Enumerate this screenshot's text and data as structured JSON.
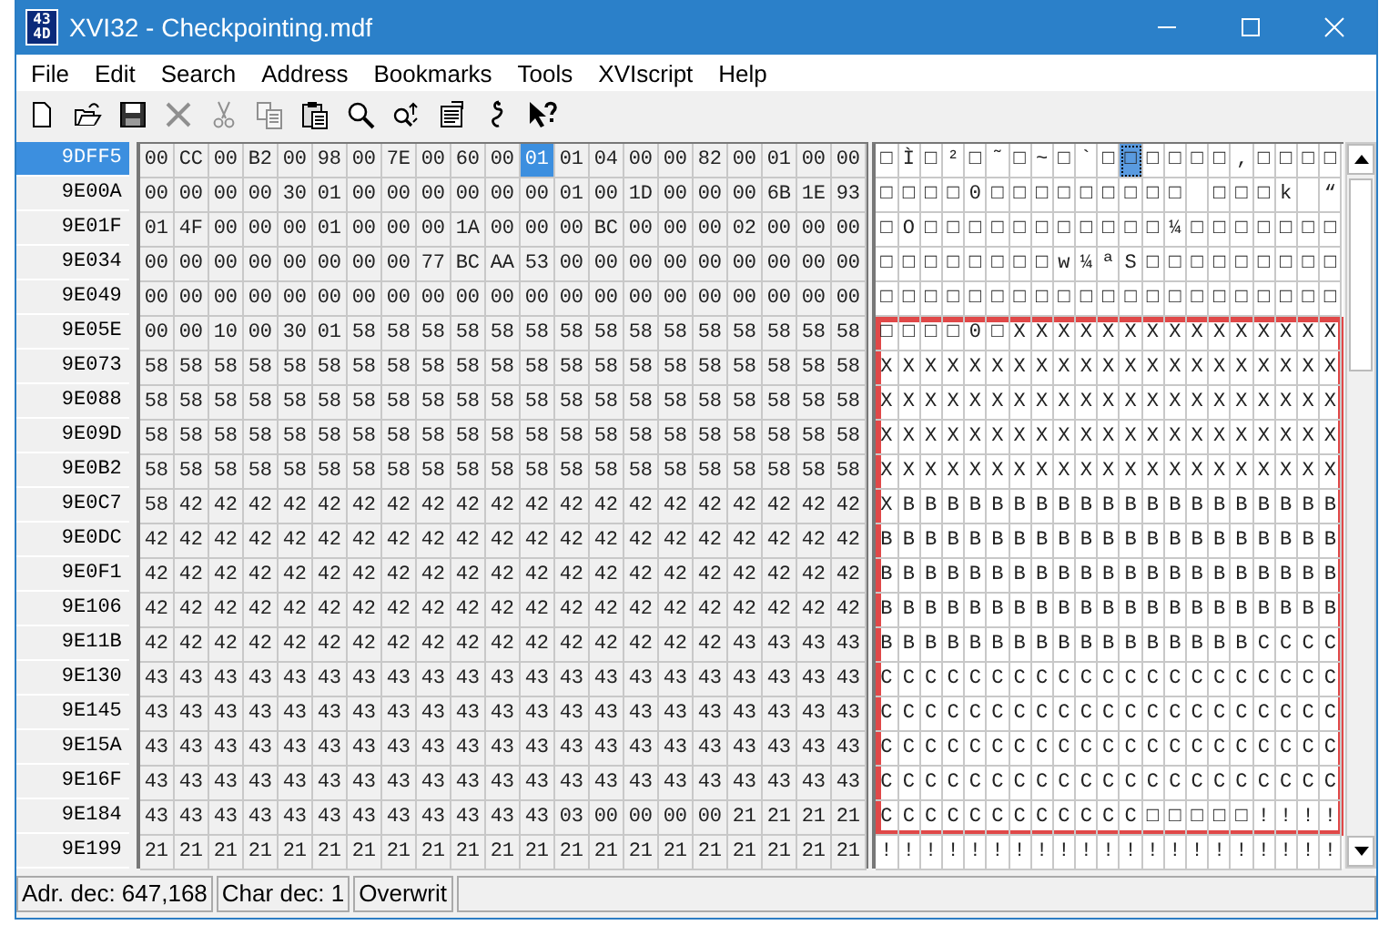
{
  "window": {
    "title": "XVI32 - Checkpointing.mdf",
    "icon_text": [
      "43",
      "4D"
    ]
  },
  "menu": [
    "File",
    "Edit",
    "Search",
    "Address",
    "Bookmarks",
    "Tools",
    "XVIscript",
    "Help"
  ],
  "toolbar": [
    {
      "kind": "new",
      "disabled": false
    },
    {
      "kind": "open",
      "disabled": false
    },
    {
      "kind": "save",
      "disabled": false
    },
    {
      "kind": "delete",
      "disabled": true
    },
    {
      "kind": "cut",
      "disabled": true
    },
    {
      "kind": "copy",
      "disabled": true
    },
    {
      "kind": "paste",
      "disabled": false
    },
    {
      "kind": "find",
      "disabled": false
    },
    {
      "kind": "replace",
      "disabled": false
    },
    {
      "kind": "properties",
      "disabled": false
    },
    {
      "kind": "hook",
      "disabled": false
    },
    {
      "kind": "help",
      "disabled": false
    }
  ],
  "rows": [
    {
      "address": "9DFF5",
      "selected": true,
      "marked": false,
      "hex": [
        "00",
        "CC",
        "00",
        "B2",
        "00",
        "98",
        "00",
        "7E",
        "00",
        "60",
        "00",
        {
          "text": "01",
          "selected": true
        },
        "01",
        "04",
        "00",
        "00",
        "82",
        "00",
        "01",
        "00",
        "00"
      ],
      "chars": [
        "□",
        "Ì",
        "□",
        "²",
        "□",
        "˜",
        "□",
        "~",
        "□",
        "`",
        "□",
        {
          "text": "□",
          "selected": true
        },
        "□",
        "□",
        "□",
        "□",
        "‚",
        "□",
        "□",
        "□",
        "□"
      ]
    },
    {
      "address": "9E00A",
      "selected": false,
      "marked": false,
      "hex": [
        "00",
        "00",
        "00",
        "00",
        "30",
        "01",
        "00",
        "00",
        "00",
        "00",
        "00",
        "00",
        "01",
        "00",
        "1D",
        "00",
        "00",
        "00",
        "6B",
        "1E",
        "93"
      ],
      "chars": [
        {
          "kind": "glyph",
          "text": "□"
        },
        {
          "kind": "glyph",
          "text": "□"
        },
        {
          "kind": "glyph",
          "text": "□"
        },
        {
          "kind": "glyph",
          "text": "□"
        },
        {
          "kind": "glyph",
          "text": "0"
        },
        {
          "kind": "glyph",
          "text": "□"
        },
        {
          "kind": "glyph",
          "text": "□"
        },
        {
          "kind": "glyph",
          "text": "□"
        },
        {
          "kind": "glyph",
          "text": "□"
        },
        {
          "kind": "glyph",
          "text": "□"
        },
        {
          "kind": "glyph",
          "text": "□"
        },
        {
          "kind": "glyph",
          "text": "□"
        },
        {
          "kind": "glyph",
          "text": "□"
        },
        {
          "kind": "glyph",
          "text": "□"
        },
        {
          "kind": "blank"
        },
        {
          "kind": "glyph",
          "text": "□"
        },
        {
          "kind": "glyph",
          "text": "□"
        },
        {
          "kind": "glyph",
          "text": "□"
        },
        {
          "kind": "glyph",
          "text": "k"
        },
        {
          "kind": "blank"
        },
        {
          "kind": "glyph",
          "text": "“"
        }
      ]
    },
    {
      "address": "9E01F",
      "selected": false,
      "marked": false,
      "hex": [
        "01",
        "4F",
        "00",
        "00",
        "00",
        "01",
        "00",
        "00",
        "00",
        "1A",
        "00",
        "00",
        "00",
        "BC",
        "00",
        "00",
        "00",
        "02",
        "00",
        "00",
        "00"
      ],
      "chars": [
        "□",
        "O",
        "□",
        "□",
        "□",
        "□",
        "□",
        "□",
        "□",
        "□",
        "□",
        "□",
        "□",
        "¼",
        "□",
        "□",
        "□",
        "□",
        "□",
        "□",
        "□"
      ]
    },
    {
      "address": "9E034",
      "selected": false,
      "marked": false,
      "hex": [
        "00",
        "00",
        "00",
        "00",
        "00",
        "00",
        "00",
        "00",
        "77",
        "BC",
        "AA",
        "53",
        "00",
        "00",
        "00",
        "00",
        "00",
        "00",
        "00",
        "00",
        "00"
      ],
      "chars": [
        "□",
        "□",
        "□",
        "□",
        "□",
        "□",
        "□",
        "□",
        "w",
        "¼",
        "ª",
        "S",
        "□",
        "□",
        "□",
        "□",
        "□",
        "□",
        "□",
        "□",
        "□"
      ]
    },
    {
      "address": "9E049",
      "selected": false,
      "marked": false,
      "hex": [
        "00",
        "00",
        "00",
        "00",
        "00",
        "00",
        "00",
        "00",
        "00",
        "00",
        "00",
        "00",
        "00",
        "00",
        "00",
        "00",
        "00",
        "00",
        "00",
        "00",
        "00"
      ],
      "chars": [
        "□",
        "□",
        "□",
        "□",
        "□",
        "□",
        "□",
        "□",
        "□",
        "□",
        "□",
        "□",
        "□",
        "□",
        "□",
        "□",
        "□",
        "□",
        "□",
        "□",
        "□"
      ]
    },
    {
      "address": "9E05E",
      "selected": false,
      "marked": true,
      "hex": [
        "00",
        "00",
        "10",
        "00",
        "30",
        "01",
        "58",
        "58",
        "58",
        "58",
        "58",
        "58",
        "58",
        "58",
        "58",
        "58",
        "58",
        "58",
        "58",
        "58",
        "58"
      ],
      "chars": [
        "□",
        "□",
        "□",
        "□",
        "0",
        "□",
        "X",
        "X",
        "X",
        "X",
        "X",
        "X",
        "X",
        "X",
        "X",
        "X",
        "X",
        "X",
        "X",
        "X",
        "X"
      ]
    },
    {
      "address": "9E073",
      "selected": false,
      "marked": true,
      "hex": [
        "58",
        "58",
        "58",
        "58",
        "58",
        "58",
        "58",
        "58",
        "58",
        "58",
        "58",
        "58",
        "58",
        "58",
        "58",
        "58",
        "58",
        "58",
        "58",
        "58",
        "58"
      ],
      "chars": [
        "X",
        "X",
        "X",
        "X",
        "X",
        "X",
        "X",
        "X",
        "X",
        "X",
        "X",
        "X",
        "X",
        "X",
        "X",
        "X",
        "X",
        "X",
        "X",
        "X",
        "X"
      ]
    },
    {
      "address": "9E088",
      "selected": false,
      "marked": true,
      "hex": [
        "58",
        "58",
        "58",
        "58",
        "58",
        "58",
        "58",
        "58",
        "58",
        "58",
        "58",
        "58",
        "58",
        "58",
        "58",
        "58",
        "58",
        "58",
        "58",
        "58",
        "58"
      ],
      "chars": [
        "X",
        "X",
        "X",
        "X",
        "X",
        "X",
        "X",
        "X",
        "X",
        "X",
        "X",
        "X",
        "X",
        "X",
        "X",
        "X",
        "X",
        "X",
        "X",
        "X",
        "X"
      ]
    },
    {
      "address": "9E09D",
      "selected": false,
      "marked": true,
      "hex": [
        "58",
        "58",
        "58",
        "58",
        "58",
        "58",
        "58",
        "58",
        "58",
        "58",
        "58",
        "58",
        "58",
        "58",
        "58",
        "58",
        "58",
        "58",
        "58",
        "58",
        "58"
      ],
      "chars": [
        "X",
        "X",
        "X",
        "X",
        "X",
        "X",
        "X",
        "X",
        "X",
        "X",
        "X",
        "X",
        "X",
        "X",
        "X",
        "X",
        "X",
        "X",
        "X",
        "X",
        "X"
      ]
    },
    {
      "address": "9E0B2",
      "selected": false,
      "marked": true,
      "hex": [
        "58",
        "58",
        "58",
        "58",
        "58",
        "58",
        "58",
        "58",
        "58",
        "58",
        "58",
        "58",
        "58",
        "58",
        "58",
        "58",
        "58",
        "58",
        "58",
        "58",
        "58"
      ],
      "chars": [
        "X",
        "X",
        "X",
        "X",
        "X",
        "X",
        "X",
        "X",
        "X",
        "X",
        "X",
        "X",
        "X",
        "X",
        "X",
        "X",
        "X",
        "X",
        "X",
        "X",
        "X"
      ]
    },
    {
      "address": "9E0C7",
      "selected": false,
      "marked": true,
      "hex": [
        "58",
        "42",
        "42",
        "42",
        "42",
        "42",
        "42",
        "42",
        "42",
        "42",
        "42",
        "42",
        "42",
        "42",
        "42",
        "42",
        "42",
        "42",
        "42",
        "42",
        "42"
      ],
      "chars": [
        "X",
        "B",
        "B",
        "B",
        "B",
        "B",
        "B",
        "B",
        "B",
        "B",
        "B",
        "B",
        "B",
        "B",
        "B",
        "B",
        "B",
        "B",
        "B",
        "B",
        "B"
      ]
    },
    {
      "address": "9E0DC",
      "selected": false,
      "marked": true,
      "hex": [
        "42",
        "42",
        "42",
        "42",
        "42",
        "42",
        "42",
        "42",
        "42",
        "42",
        "42",
        "42",
        "42",
        "42",
        "42",
        "42",
        "42",
        "42",
        "42",
        "42",
        "42"
      ],
      "chars": [
        "B",
        "B",
        "B",
        "B",
        "B",
        "B",
        "B",
        "B",
        "B",
        "B",
        "B",
        "B",
        "B",
        "B",
        "B",
        "B",
        "B",
        "B",
        "B",
        "B",
        "B"
      ]
    },
    {
      "address": "9E0F1",
      "selected": false,
      "marked": true,
      "hex": [
        "42",
        "42",
        "42",
        "42",
        "42",
        "42",
        "42",
        "42",
        "42",
        "42",
        "42",
        "42",
        "42",
        "42",
        "42",
        "42",
        "42",
        "42",
        "42",
        "42",
        "42"
      ],
      "chars": [
        "B",
        "B",
        "B",
        "B",
        "B",
        "B",
        "B",
        "B",
        "B",
        "B",
        "B",
        "B",
        "B",
        "B",
        "B",
        "B",
        "B",
        "B",
        "B",
        "B",
        "B"
      ]
    },
    {
      "address": "9E106",
      "selected": false,
      "marked": true,
      "hex": [
        "42",
        "42",
        "42",
        "42",
        "42",
        "42",
        "42",
        "42",
        "42",
        "42",
        "42",
        "42",
        "42",
        "42",
        "42",
        "42",
        "42",
        "42",
        "42",
        "42",
        "42"
      ],
      "chars": [
        "B",
        "B",
        "B",
        "B",
        "B",
        "B",
        "B",
        "B",
        "B",
        "B",
        "B",
        "B",
        "B",
        "B",
        "B",
        "B",
        "B",
        "B",
        "B",
        "B",
        "B"
      ]
    },
    {
      "address": "9E11B",
      "selected": false,
      "marked": true,
      "hex": [
        "42",
        "42",
        "42",
        "42",
        "42",
        "42",
        "42",
        "42",
        "42",
        "42",
        "42",
        "42",
        "42",
        "42",
        "42",
        "42",
        "42",
        "43",
        "43",
        "43",
        "43"
      ],
      "chars": [
        "B",
        "B",
        "B",
        "B",
        "B",
        "B",
        "B",
        "B",
        "B",
        "B",
        "B",
        "B",
        "B",
        "B",
        "B",
        "B",
        "B",
        "C",
        "C",
        "C",
        "C"
      ]
    },
    {
      "address": "9E130",
      "selected": false,
      "marked": true,
      "hex": [
        "43",
        "43",
        "43",
        "43",
        "43",
        "43",
        "43",
        "43",
        "43",
        "43",
        "43",
        "43",
        "43",
        "43",
        "43",
        "43",
        "43",
        "43",
        "43",
        "43",
        "43"
      ],
      "chars": [
        "C",
        "C",
        "C",
        "C",
        "C",
        "C",
        "C",
        "C",
        "C",
        "C",
        "C",
        "C",
        "C",
        "C",
        "C",
        "C",
        "C",
        "C",
        "C",
        "C",
        "C"
      ]
    },
    {
      "address": "9E145",
      "selected": false,
      "marked": true,
      "hex": [
        "43",
        "43",
        "43",
        "43",
        "43",
        "43",
        "43",
        "43",
        "43",
        "43",
        "43",
        "43",
        "43",
        "43",
        "43",
        "43",
        "43",
        "43",
        "43",
        "43",
        "43"
      ],
      "chars": [
        "C",
        "C",
        "C",
        "C",
        "C",
        "C",
        "C",
        "C",
        "C",
        "C",
        "C",
        "C",
        "C",
        "C",
        "C",
        "C",
        "C",
        "C",
        "C",
        "C",
        "C"
      ]
    },
    {
      "address": "9E15A",
      "selected": false,
      "marked": true,
      "hex": [
        "43",
        "43",
        "43",
        "43",
        "43",
        "43",
        "43",
        "43",
        "43",
        "43",
        "43",
        "43",
        "43",
        "43",
        "43",
        "43",
        "43",
        "43",
        "43",
        "43",
        "43"
      ],
      "chars": [
        "C",
        "C",
        "C",
        "C",
        "C",
        "C",
        "C",
        "C",
        "C",
        "C",
        "C",
        "C",
        "C",
        "C",
        "C",
        "C",
        "C",
        "C",
        "C",
        "C",
        "C"
      ]
    },
    {
      "address": "9E16F",
      "selected": false,
      "marked": true,
      "hex": [
        "43",
        "43",
        "43",
        "43",
        "43",
        "43",
        "43",
        "43",
        "43",
        "43",
        "43",
        "43",
        "43",
        "43",
        "43",
        "43",
        "43",
        "43",
        "43",
        "43",
        "43"
      ],
      "chars": [
        "C",
        "C",
        "C",
        "C",
        "C",
        "C",
        "C",
        "C",
        "C",
        "C",
        "C",
        "C",
        "C",
        "C",
        "C",
        "C",
        "C",
        "C",
        "C",
        "C",
        "C"
      ]
    },
    {
      "address": "9E184",
      "selected": false,
      "marked": true,
      "hex": [
        "43",
        "43",
        "43",
        "43",
        "43",
        "43",
        "43",
        "43",
        "43",
        "43",
        "43",
        "43",
        "03",
        "00",
        "00",
        "00",
        "00",
        "21",
        "21",
        "21",
        "21"
      ],
      "chars": [
        "C",
        "C",
        "C",
        "C",
        "C",
        "C",
        "C",
        "C",
        "C",
        "C",
        "C",
        "C",
        "□",
        "□",
        "□",
        "□",
        "□",
        "!",
        "!",
        "!",
        "!"
      ]
    },
    {
      "address": "9E199",
      "selected": false,
      "marked": false,
      "hex": [
        "21",
        "21",
        "21",
        "21",
        "21",
        "21",
        "21",
        "21",
        "21",
        "21",
        "21",
        "21",
        "21",
        "21",
        "21",
        "21",
        "21",
        "21",
        "21",
        "21",
        "21"
      ],
      "chars": [
        "!",
        "!",
        "!",
        "!",
        "!",
        "!",
        "!",
        "!",
        "!",
        "!",
        "!",
        "!",
        "!",
        "!",
        "!",
        "!",
        "!",
        "!",
        "!",
        "!",
        "!"
      ]
    }
  ],
  "status_bar": [
    "Adr. dec: 647,168",
    "Char dec: 1",
    "Overwrit"
  ]
}
